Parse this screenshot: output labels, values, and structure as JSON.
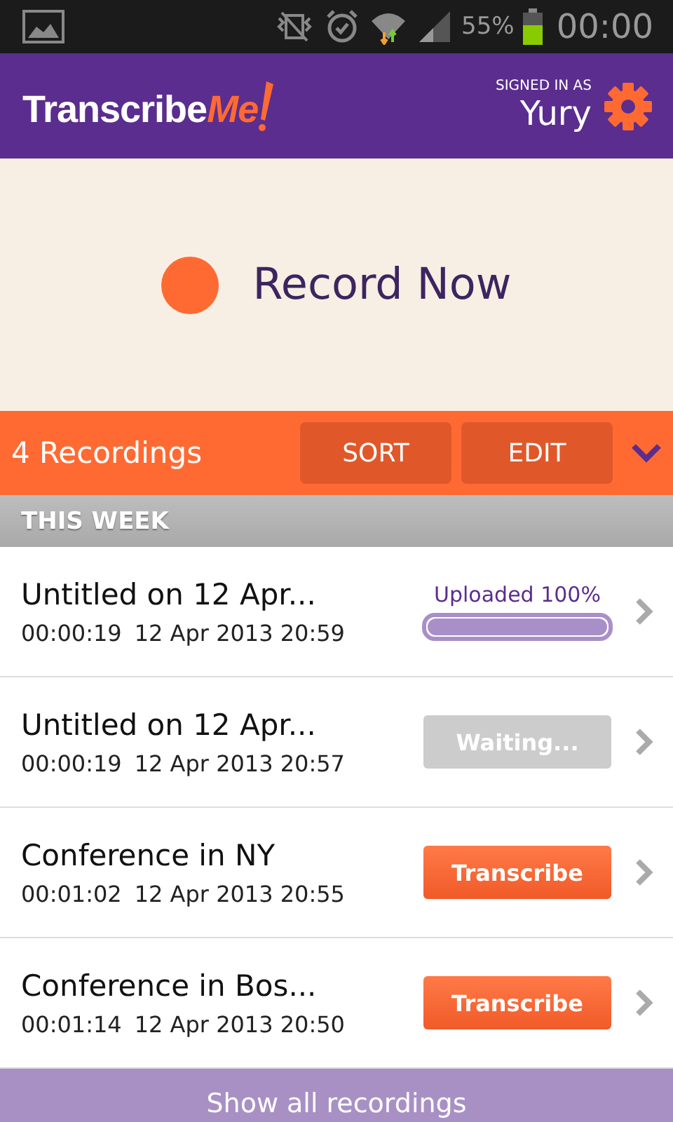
{
  "status_bar": {
    "battery": "55%",
    "time": "00:00"
  },
  "header": {
    "logo": "Transcribe",
    "logo_accent": "Me",
    "signed_in_label": "SIGNED IN AS",
    "user": "Yury"
  },
  "record": {
    "label": "Record Now"
  },
  "toolbar": {
    "count": "4 Recordings",
    "buttons": [
      "SORT",
      "EDIT"
    ]
  },
  "section": "THIS WEEK",
  "recordings": [
    {
      "title": "Untitled on 12 Apr...",
      "duration": "00:00:19",
      "date": "12 Apr 2013 20:59",
      "kind": "progress",
      "status": "Uploaded 100%",
      "level": 1
    },
    {
      "title": "Untitled on 12 Apr...",
      "duration": "00:00:19",
      "date": "12 Apr 2013 20:57",
      "kind": "waiting",
      "status": "Waiting..."
    },
    {
      "title": "Conference in NY",
      "duration": "00:01:02",
      "date": "12 Apr 2013 20:55",
      "kind": "button",
      "status": "Transcribe"
    },
    {
      "title": "Conference in Bos...",
      "duration": "00:01:14",
      "date": "12 Apr 2013 20:50",
      "kind": "button",
      "status": "Transcribe"
    }
  ],
  "footer": {
    "label": "Show all recordings"
  }
}
